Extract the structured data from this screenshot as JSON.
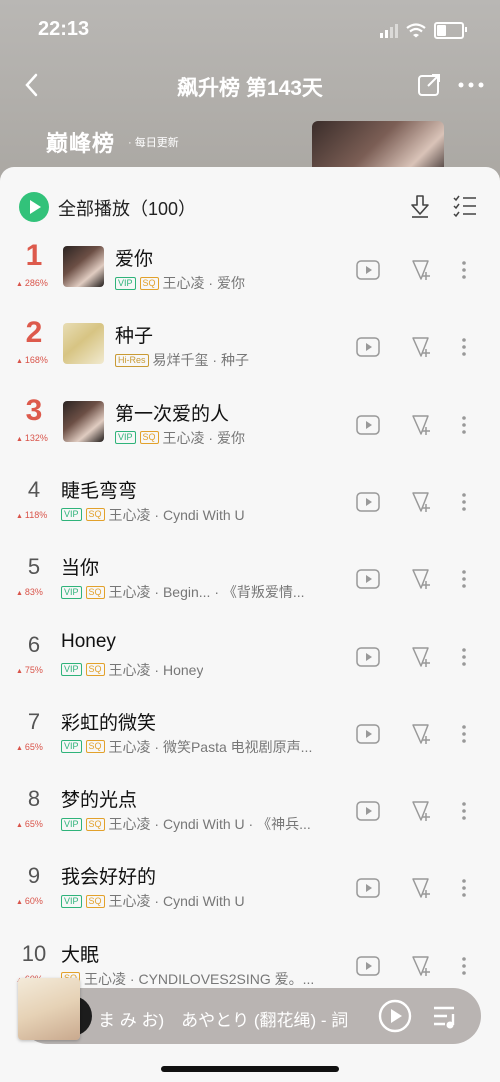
{
  "status": {
    "time": "22:13"
  },
  "nav": {
    "title": "飙升榜 第143天"
  },
  "banner": {
    "brand": "巅峰榜",
    "update": "· 每日更新"
  },
  "playall": {
    "label": "全部播放（100）"
  },
  "colors": {
    "accent": "#32c27a",
    "rank_top": "#dd5a4c",
    "trend_up": "#d9544a"
  },
  "songs": [
    {
      "rank": "1",
      "trend": "286%",
      "title": "爱你",
      "badges": [
        "VIP",
        "SQ"
      ],
      "meta": "王心凌 · 爱你",
      "cover": "dark"
    },
    {
      "rank": "2",
      "trend": "168%",
      "title": "种子",
      "badges": [
        "Hi-Res"
      ],
      "meta": "易烊千玺 · 种子",
      "cover": "light"
    },
    {
      "rank": "3",
      "trend": "132%",
      "title": "第一次爱的人",
      "badges": [
        "VIP",
        "SQ"
      ],
      "meta": "王心凌 · 爱你",
      "cover": "dark"
    },
    {
      "rank": "4",
      "trend": "118%",
      "title": "睫毛弯弯",
      "badges": [
        "VIP",
        "SQ"
      ],
      "meta": "王心凌 · Cyndi With U"
    },
    {
      "rank": "5",
      "trend": "83%",
      "title": "当你",
      "badges": [
        "VIP",
        "SQ"
      ],
      "meta": "王心凌 · Begin... · 《背叛爱情..."
    },
    {
      "rank": "6",
      "trend": "75%",
      "title": "Honey",
      "badges": [
        "VIP",
        "SQ"
      ],
      "meta": "王心凌 · Honey"
    },
    {
      "rank": "7",
      "trend": "65%",
      "title": "彩虹的微笑",
      "badges": [
        "VIP",
        "SQ"
      ],
      "meta": "王心凌 · 微笑Pasta 电视剧原声..."
    },
    {
      "rank": "8",
      "trend": "65%",
      "title": "梦的光点",
      "badges": [
        "VIP",
        "SQ"
      ],
      "meta": "王心凌 · Cyndi With U · 《神兵..."
    },
    {
      "rank": "9",
      "trend": "60%",
      "title": "我会好好的",
      "badges": [
        "VIP",
        "SQ"
      ],
      "meta": "王心凌 · Cyndi With U"
    },
    {
      "rank": "10",
      "trend": "60%",
      "title": "大眠",
      "badges": [
        "SQ"
      ],
      "meta": "王心凌 · CYNDILOVES2SING 爱。..."
    }
  ],
  "player": {
    "now_playing": "ま み お)　あやとり (翻花绳) - 詞"
  }
}
